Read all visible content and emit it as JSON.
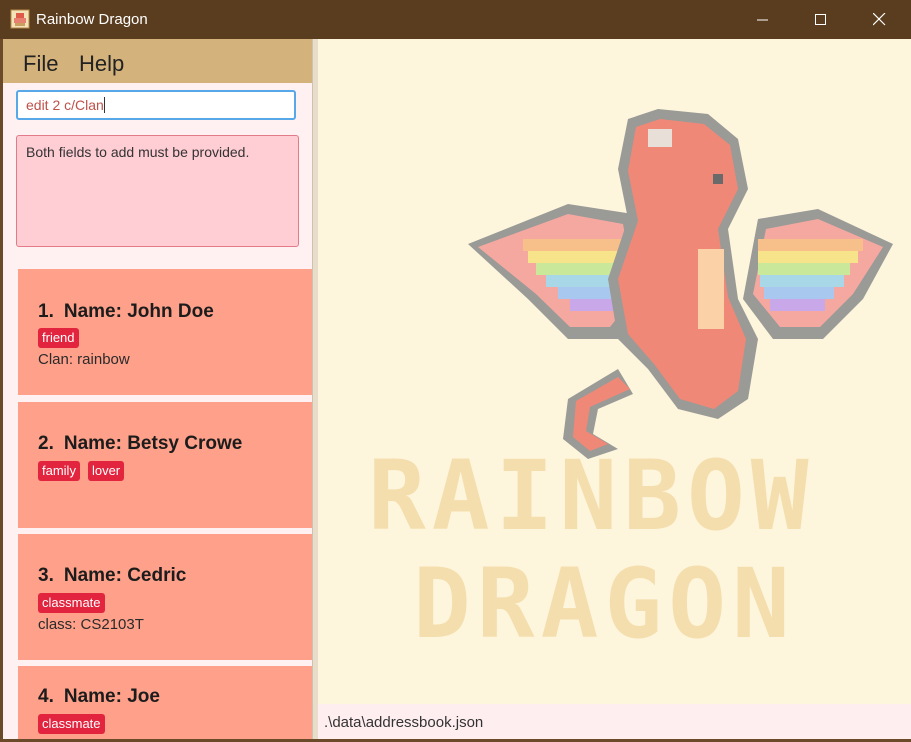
{
  "window": {
    "title": "Rainbow Dragon",
    "controls": [
      "minimize-icon",
      "maximize-icon",
      "close-icon"
    ]
  },
  "menu": {
    "file_label": "File",
    "help_label": "Help"
  },
  "command_box": {
    "value": "edit 2 c/Clan"
  },
  "result_display": {
    "text": "Both fields to add must be provided."
  },
  "persons": [
    {
      "index": "1.",
      "name": "Name: John Doe",
      "tags": [
        "friend"
      ],
      "field": "Clan: rainbow"
    },
    {
      "index": "2.",
      "name": "Name: Betsy Crowe",
      "tags": [
        "family",
        "lover"
      ],
      "field": ""
    },
    {
      "index": "3.",
      "name": "Name: Cedric",
      "tags": [
        "classmate"
      ],
      "field": "class: CS2103T"
    },
    {
      "index": "4.",
      "name": "Name: Joe",
      "tags": [
        "classmate"
      ],
      "field": ""
    }
  ],
  "logo": {
    "line1": "RAINBOW",
    "line2": "DRAGON"
  },
  "status_bar": {
    "path": ".\\data\\addressbook.json"
  },
  "colors": {
    "title_bar": "#5a3c1e",
    "menu_bar": "#d4b27c",
    "card": "#ffa18a",
    "tag": "#e3243e",
    "result_box": "#ffcdd4",
    "background": "#fdf6dc"
  }
}
